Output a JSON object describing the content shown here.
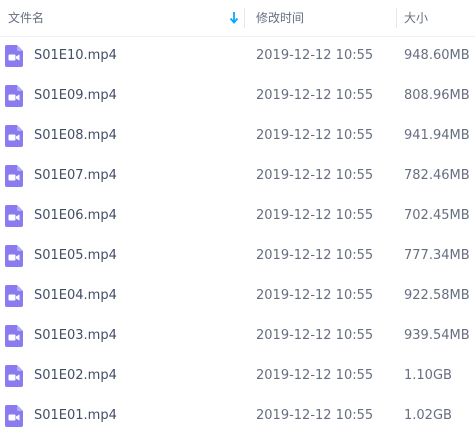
{
  "header": {
    "name_label": "文件名",
    "time_label": "修改时间",
    "size_label": "大小",
    "sort_icon": "arrow-down-icon",
    "sort_color": "#06a7ff"
  },
  "file_icon": {
    "name": "video-file-icon",
    "color": "#8a7cf0"
  },
  "files": [
    {
      "name": "S01E10.mp4",
      "modified": "2019-12-12 10:55",
      "size": "948.60MB"
    },
    {
      "name": "S01E09.mp4",
      "modified": "2019-12-12 10:55",
      "size": "808.96MB"
    },
    {
      "name": "S01E08.mp4",
      "modified": "2019-12-12 10:55",
      "size": "941.94MB"
    },
    {
      "name": "S01E07.mp4",
      "modified": "2019-12-12 10:55",
      "size": "782.46MB"
    },
    {
      "name": "S01E06.mp4",
      "modified": "2019-12-12 10:55",
      "size": "702.45MB"
    },
    {
      "name": "S01E05.mp4",
      "modified": "2019-12-12 10:55",
      "size": "777.34MB"
    },
    {
      "name": "S01E04.mp4",
      "modified": "2019-12-12 10:55",
      "size": "922.58MB"
    },
    {
      "name": "S01E03.mp4",
      "modified": "2019-12-12 10:55",
      "size": "939.54MB"
    },
    {
      "name": "S01E02.mp4",
      "modified": "2019-12-12 10:55",
      "size": "1.10GB"
    },
    {
      "name": "S01E01.mp4",
      "modified": "2019-12-12 10:55",
      "size": "1.02GB"
    }
  ]
}
